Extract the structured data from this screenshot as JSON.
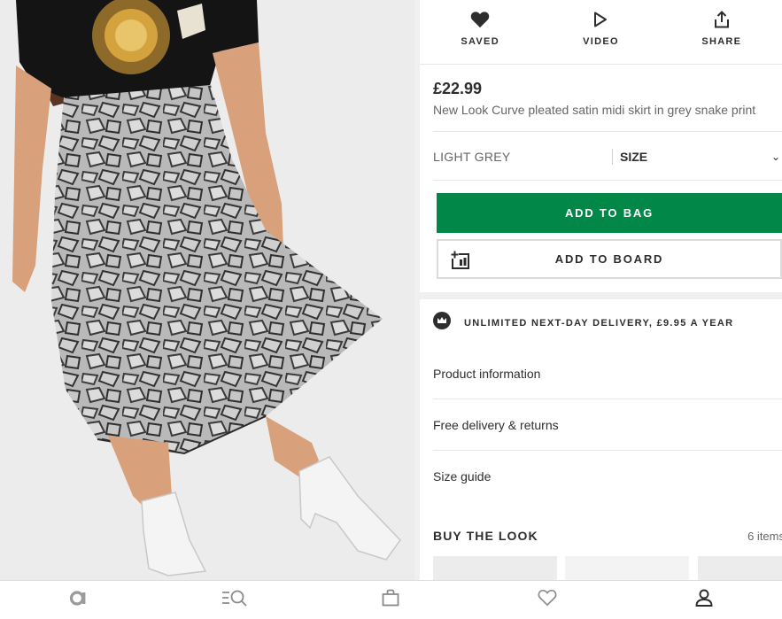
{
  "product_actions": {
    "saved_label": "SAVED",
    "video_label": "VIDEO",
    "share_label": "SHARE"
  },
  "product": {
    "price": "£22.99",
    "title": "New Look Curve pleated satin midi skirt in grey snake print",
    "colour": "LIGHT GREY",
    "size_placeholder": "SIZE"
  },
  "buttons": {
    "add_to_bag": "ADD TO BAG",
    "add_to_board": "ADD TO BOARD"
  },
  "premier": {
    "text": "UNLIMITED NEXT-DAY DELIVERY, £9.95 A YEAR"
  },
  "info_links": [
    {
      "label": "Product information"
    },
    {
      "label": "Free delivery & returns"
    },
    {
      "label": "Size guide"
    }
  ],
  "buy_the_look": {
    "heading": "BUY THE LOOK",
    "count": "6 items"
  },
  "bottom_nav": {
    "items": [
      "home-icon",
      "search-icon",
      "bag-icon",
      "saved-icon",
      "account-icon"
    ]
  },
  "colors": {
    "accent_green": "#018849",
    "text_dark": "#2d2d2d",
    "text_muted": "#666666"
  }
}
